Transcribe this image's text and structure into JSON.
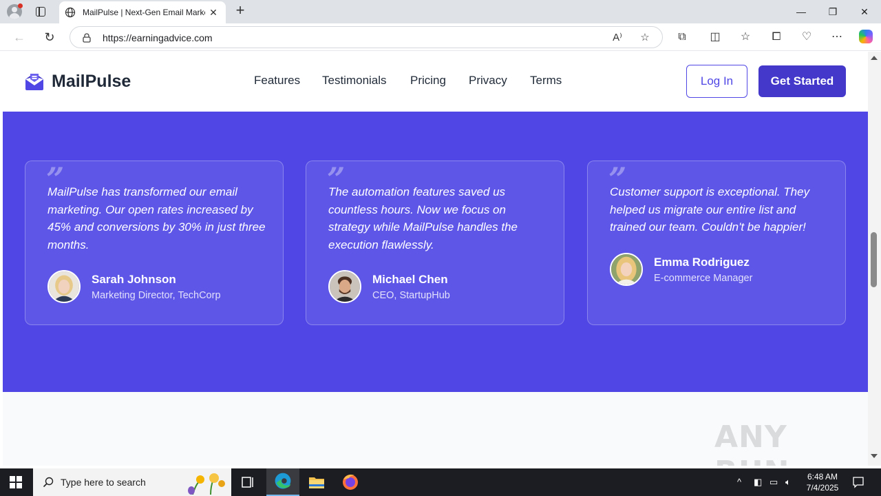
{
  "browser": {
    "tab_title": "MailPulse | Next-Gen Email Marke",
    "url": "https://earningadvice.com",
    "new_tab_glyph": "+",
    "tab_close_glyph": "✕",
    "window_controls": {
      "minimize": "—",
      "restore": "❐",
      "close": "✕"
    }
  },
  "site": {
    "brand": "MailPulse",
    "nav": [
      "Features",
      "Testimonials",
      "Pricing",
      "Privacy",
      "Terms"
    ],
    "login_label": "Log In",
    "cta_label": "Get Started",
    "accent_color": "#4f46e5"
  },
  "testimonials": [
    {
      "quote": "MailPulse has transformed our email marketing. Our open rates increased by 45% and conversions by 30% in just three months.",
      "name": "Sarah Johnson",
      "role": "Marketing Director, TechCorp"
    },
    {
      "quote": "The automation features saved us countless hours. Now we focus on strategy while MailPulse handles the execution flawlessly.",
      "name": "Michael Chen",
      "role": "CEO, StartupHub"
    },
    {
      "quote": "Customer support is exceptional. They helped us migrate our entire list and trained our team. Couldn't be happier!",
      "name": "Emma Rodriguez",
      "role": "E-commerce Manager"
    }
  ],
  "quote_mark": "”",
  "watermark": "ANY RUN",
  "taskbar": {
    "search_placeholder": "Type here to search",
    "time": "6:48 AM",
    "date": "7/4/2025"
  }
}
